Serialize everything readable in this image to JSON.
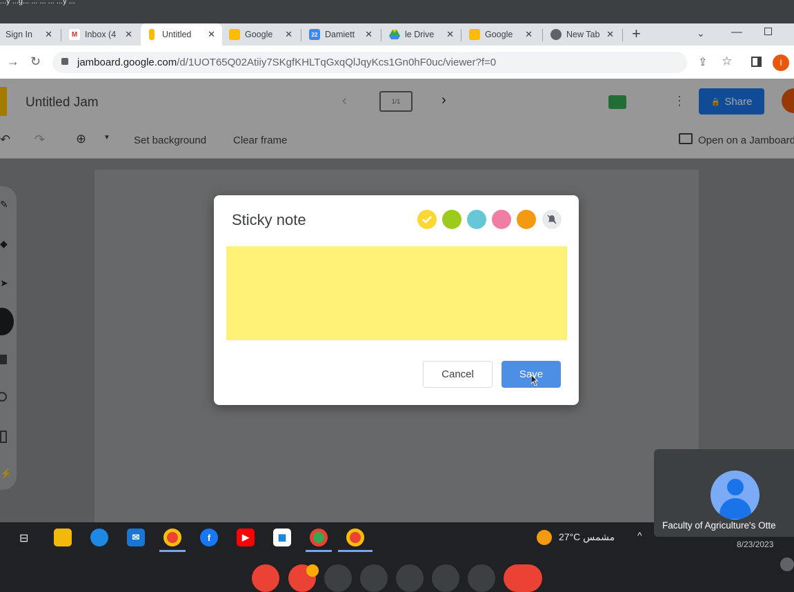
{
  "meet_caption": "...y ...g... ... ... ... ...y ...",
  "tabs": [
    {
      "label": "Sign In",
      "active": false
    },
    {
      "label": "Inbox (4",
      "active": false
    },
    {
      "label": "Untitled",
      "active": true
    },
    {
      "label": "Google",
      "active": false
    },
    {
      "label": "Damiett",
      "active": false
    },
    {
      "label": "le Drive",
      "active": false
    },
    {
      "label": "Google",
      "active": false
    },
    {
      "label": "New Tab",
      "active": false
    }
  ],
  "new_tab_label": "+",
  "address": {
    "host": "jamboard.google.com",
    "path": "/d/1UOT65Q02Atiiy7SKgfKHLTqGxqQlJqyKcs1Gn0hF0uc/viewer?f=0"
  },
  "profile_initial": "I",
  "jam": {
    "title": "Untitled Jam",
    "frame_counter": "1/1",
    "share_label": "Share",
    "toolbar": {
      "set_background": "Set background",
      "clear_frame": "Clear frame",
      "open_on_jamboard": "Open on a Jamboard"
    }
  },
  "dialog": {
    "title": "Sticky note",
    "note_text": "",
    "cancel_label": "Cancel",
    "save_label": "Save",
    "colors": [
      {
        "name": "yellow",
        "hex": "#fdd835",
        "selected": true
      },
      {
        "name": "green",
        "hex": "#9ccc1b"
      },
      {
        "name": "teal",
        "hex": "#66c8d6"
      },
      {
        "name": "pink",
        "hex": "#f07ea4"
      },
      {
        "name": "orange",
        "hex": "#f39a12"
      }
    ],
    "note_color": "#fff176"
  },
  "taskbar": {
    "weather": "27°C مشمس",
    "date": "8/23/2023"
  },
  "video": {
    "participant": "Faculty of Agriculture's Otte"
  }
}
